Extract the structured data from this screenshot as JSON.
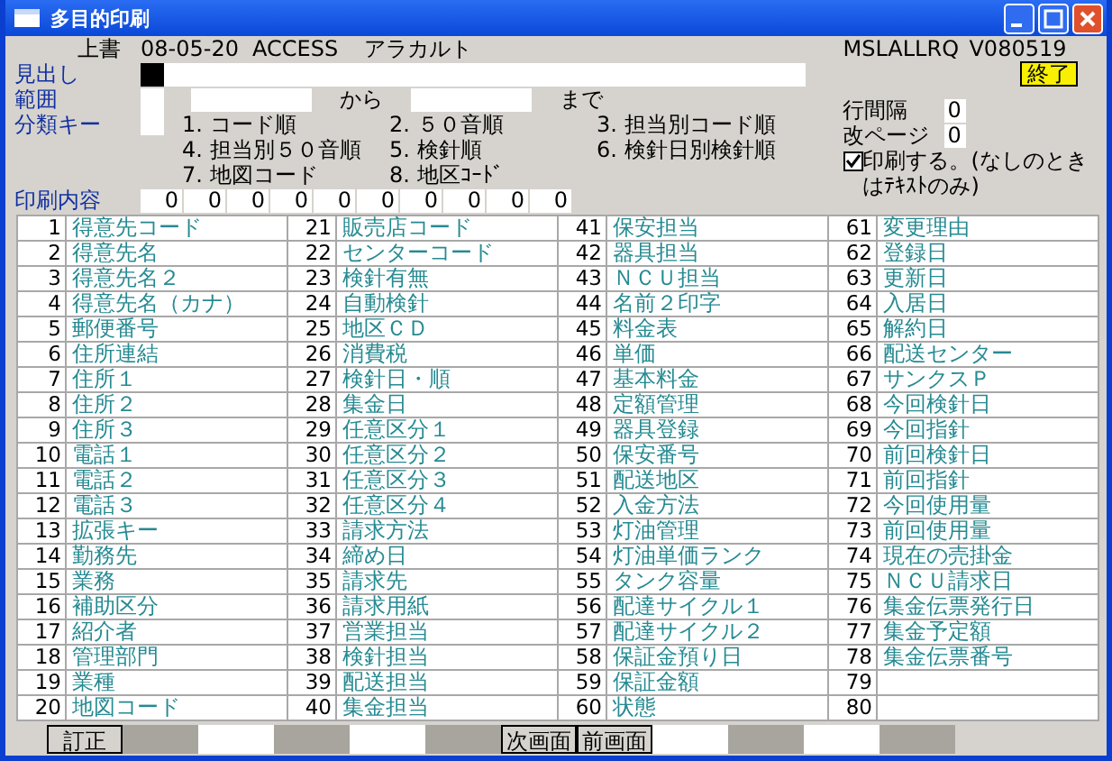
{
  "window": {
    "title": "多目的印刷"
  },
  "header": {
    "mode": "上書",
    "date": "08-05-20",
    "system": "ACCESS",
    "menu": "アラカルト",
    "program": "MSLALLRQ",
    "version": "V080519"
  },
  "exit_button": "終了",
  "heading": {
    "label": "見出し"
  },
  "range": {
    "label": "範囲",
    "from": "から",
    "to": "まで"
  },
  "sort_key": {
    "label": "分類キー",
    "options": [
      {
        "number": "1.",
        "label": "コード順"
      },
      {
        "number": "2.",
        "label": "５０音順"
      },
      {
        "number": "3.",
        "label": "担当別コード順"
      },
      {
        "number": "4.",
        "label": "担当別５０音順"
      },
      {
        "number": "5.",
        "label": "検針順"
      },
      {
        "number": "6.",
        "label": "検針日別検針順"
      },
      {
        "number": "7.",
        "label": "地図コード"
      },
      {
        "number": "8.",
        "label": "地区ｺｰﾄﾞ"
      }
    ]
  },
  "line_spacing": {
    "label": "行間隔",
    "value": "0"
  },
  "page_break": {
    "label": "改ページ",
    "value": "0"
  },
  "print_option": {
    "label": "印刷する。(なしのときはﾃｷｽﾄのみ)",
    "checked": true
  },
  "print_content": {
    "label": "印刷内容",
    "values": [
      "0",
      "0",
      "0",
      "0",
      "0",
      "0",
      "0",
      "0",
      "0",
      "0"
    ]
  },
  "items": [
    {
      "number": "1",
      "label": "得意先コード"
    },
    {
      "number": "2",
      "label": "得意先名"
    },
    {
      "number": "3",
      "label": "得意先名２"
    },
    {
      "number": "4",
      "label": "得意先名（カナ）"
    },
    {
      "number": "5",
      "label": "郵便番号"
    },
    {
      "number": "6",
      "label": "住所連結"
    },
    {
      "number": "7",
      "label": "住所１"
    },
    {
      "number": "8",
      "label": "住所２"
    },
    {
      "number": "9",
      "label": "住所３"
    },
    {
      "number": "10",
      "label": "電話１"
    },
    {
      "number": "11",
      "label": "電話２"
    },
    {
      "number": "12",
      "label": "電話３"
    },
    {
      "number": "13",
      "label": "拡張キー"
    },
    {
      "number": "14",
      "label": "勤務先"
    },
    {
      "number": "15",
      "label": "業務"
    },
    {
      "number": "16",
      "label": "補助区分"
    },
    {
      "number": "17",
      "label": "紹介者"
    },
    {
      "number": "18",
      "label": "管理部門"
    },
    {
      "number": "19",
      "label": "業種"
    },
    {
      "number": "20",
      "label": "地図コード"
    },
    {
      "number": "21",
      "label": "販売店コード"
    },
    {
      "number": "22",
      "label": "センターコード"
    },
    {
      "number": "23",
      "label": "検針有無"
    },
    {
      "number": "24",
      "label": "自動検針"
    },
    {
      "number": "25",
      "label": "地区ＣＤ"
    },
    {
      "number": "26",
      "label": "消費税"
    },
    {
      "number": "27",
      "label": "検針日・順"
    },
    {
      "number": "28",
      "label": "集金日"
    },
    {
      "number": "29",
      "label": "任意区分１"
    },
    {
      "number": "30",
      "label": "任意区分２"
    },
    {
      "number": "31",
      "label": "任意区分３"
    },
    {
      "number": "32",
      "label": "任意区分４"
    },
    {
      "number": "33",
      "label": "請求方法"
    },
    {
      "number": "34",
      "label": "締め日"
    },
    {
      "number": "35",
      "label": "請求先"
    },
    {
      "number": "36",
      "label": "請求用紙"
    },
    {
      "number": "37",
      "label": "営業担当"
    },
    {
      "number": "38",
      "label": "検針担当"
    },
    {
      "number": "39",
      "label": "配送担当"
    },
    {
      "number": "40",
      "label": "集金担当"
    },
    {
      "number": "41",
      "label": "保安担当"
    },
    {
      "number": "42",
      "label": "器具担当"
    },
    {
      "number": "43",
      "label": "ＮＣＵ担当"
    },
    {
      "number": "44",
      "label": "名前２印字"
    },
    {
      "number": "45",
      "label": "料金表"
    },
    {
      "number": "46",
      "label": "単価"
    },
    {
      "number": "47",
      "label": "基本料金"
    },
    {
      "number": "48",
      "label": "定額管理"
    },
    {
      "number": "49",
      "label": "器具登録"
    },
    {
      "number": "50",
      "label": "保安番号"
    },
    {
      "number": "51",
      "label": "配送地区"
    },
    {
      "number": "52",
      "label": "入金方法"
    },
    {
      "number": "53",
      "label": "灯油管理"
    },
    {
      "number": "54",
      "label": "灯油単価ランク"
    },
    {
      "number": "55",
      "label": "タンク容量"
    },
    {
      "number": "56",
      "label": "配達サイクル１"
    },
    {
      "number": "57",
      "label": "配達サイクル２"
    },
    {
      "number": "58",
      "label": "保証金預り日"
    },
    {
      "number": "59",
      "label": "保証金額"
    },
    {
      "number": "60",
      "label": "状態"
    },
    {
      "number": "61",
      "label": "変更理由"
    },
    {
      "number": "62",
      "label": "登録日"
    },
    {
      "number": "63",
      "label": "更新日"
    },
    {
      "number": "64",
      "label": "入居日"
    },
    {
      "number": "65",
      "label": "解約日"
    },
    {
      "number": "66",
      "label": "配送センター"
    },
    {
      "number": "67",
      "label": "サンクスＰ"
    },
    {
      "number": "68",
      "label": "今回検針日"
    },
    {
      "number": "69",
      "label": "今回指針"
    },
    {
      "number": "70",
      "label": "前回検針日"
    },
    {
      "number": "71",
      "label": "前回指針"
    },
    {
      "number": "72",
      "label": "今回使用量"
    },
    {
      "number": "73",
      "label": "前回使用量"
    },
    {
      "number": "74",
      "label": "現在の売掛金"
    },
    {
      "number": "75",
      "label": "ＮＣＵ請求日"
    },
    {
      "number": "76",
      "label": "集金伝票発行日"
    },
    {
      "number": "77",
      "label": "集金予定額"
    },
    {
      "number": "78",
      "label": "集金伝票番号"
    },
    {
      "number": "79"
    },
    {
      "number": "80"
    }
  ],
  "function_keys": [
    {
      "kind": "button",
      "label": "訂正"
    },
    {
      "kind": "dark"
    },
    {
      "kind": "light"
    },
    {
      "kind": "dark"
    },
    {
      "kind": "light"
    },
    {
      "kind": "dark"
    },
    {
      "kind": "button",
      "label": "次画面"
    },
    {
      "kind": "button",
      "label": "前画面"
    },
    {
      "kind": "light"
    },
    {
      "kind": "dark"
    },
    {
      "kind": "light"
    },
    {
      "kind": "dark"
    }
  ]
}
